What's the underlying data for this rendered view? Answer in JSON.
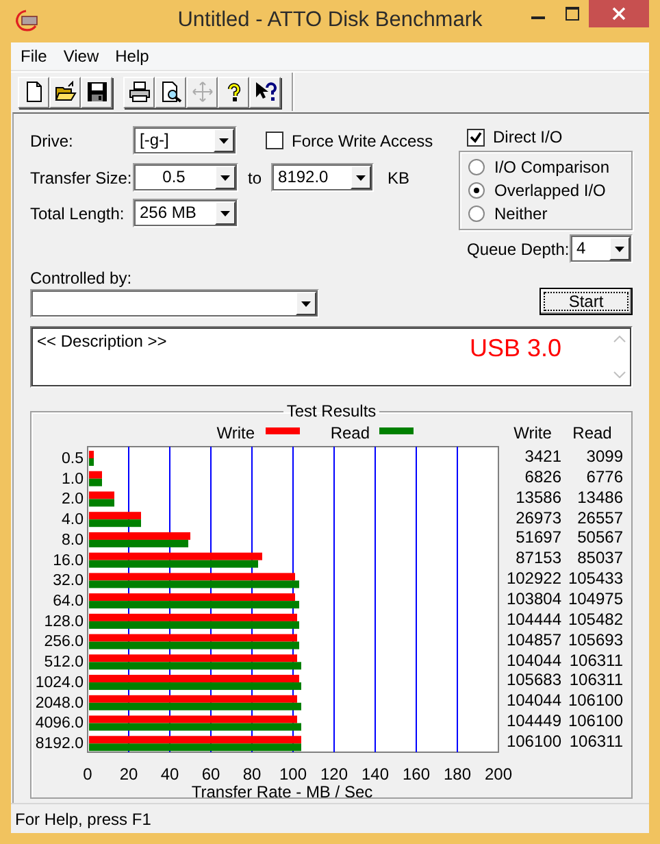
{
  "window": {
    "title": "Untitled - ATTO Disk Benchmark"
  },
  "menu": [
    "File",
    "View",
    "Help"
  ],
  "toolbar_groups": [
    [
      {
        "kind": "new",
        "disabled": false
      },
      {
        "kind": "open",
        "disabled": false
      },
      {
        "kind": "save",
        "disabled": false
      }
    ],
    [
      {
        "kind": "print",
        "disabled": false
      },
      {
        "kind": "preview",
        "disabled": false
      },
      {
        "kind": "move",
        "disabled": true
      },
      {
        "kind": "help",
        "disabled": false
      },
      {
        "kind": "context_help",
        "disabled": false
      }
    ]
  ],
  "form": {
    "drive": {
      "label": "Drive:",
      "value": "[-g-]"
    },
    "force_write_access": {
      "label": "Force Write Access",
      "checked": false
    },
    "direct_io": {
      "label": "Direct I/O",
      "checked": true
    },
    "transfer_size": {
      "label": "Transfer Size:",
      "from": "0.5",
      "to_label": "to",
      "to": "8192.0",
      "unit": "KB"
    },
    "total_length": {
      "label": "Total Length:",
      "value": "256 MB"
    },
    "io_mode": [
      {
        "label": "I/O Comparison",
        "selected": false
      },
      {
        "label": "Overlapped I/O",
        "selected": true
      },
      {
        "label": "Neither",
        "selected": false
      }
    ],
    "queue_depth": {
      "label": "Queue Depth:",
      "value": "4"
    },
    "controlled_by": {
      "label": "Controlled by:"
    },
    "start_button": "Start",
    "description": {
      "text": "<< Description >>",
      "note": "USB 3.0"
    }
  },
  "results": {
    "title": "Test Results",
    "chart_data": {
      "type": "bar",
      "orientation": "horizontal",
      "xlabel": "Transfer Rate - MB / Sec",
      "categories": [
        "0.5",
        "1.0",
        "2.0",
        "4.0",
        "8.0",
        "16.0",
        "32.0",
        "64.0",
        "128.0",
        "256.0",
        "512.0",
        "1024.0",
        "2048.0",
        "4096.0",
        "8192.0"
      ],
      "series": [
        {
          "name": "Write",
          "color": "#ff0000",
          "values": [
            3,
            7,
            13,
            26,
            50,
            85,
            101,
            101,
            102,
            102,
            102,
            103,
            102,
            102,
            104
          ]
        },
        {
          "name": "Read",
          "color": "#008000",
          "values": [
            3,
            7,
            13,
            26,
            49,
            83,
            103,
            103,
            103,
            103,
            104,
            104,
            104,
            104,
            104
          ]
        }
      ],
      "legend": true,
      "grid": true,
      "xlim": [
        0,
        200
      ],
      "xticks": [
        0,
        20,
        40,
        60,
        80,
        100,
        120,
        140,
        160,
        180,
        200
      ]
    },
    "table": {
      "columns": [
        "Write",
        "Read"
      ],
      "rows": [
        [
          "3421",
          "3099"
        ],
        [
          "6826",
          "6776"
        ],
        [
          "13586",
          "13486"
        ],
        [
          "26973",
          "26557"
        ],
        [
          "51697",
          "50567"
        ],
        [
          "87153",
          "85037"
        ],
        [
          "102922",
          "105433"
        ],
        [
          "103804",
          "104975"
        ],
        [
          "104444",
          "105482"
        ],
        [
          "104857",
          "105693"
        ],
        [
          "104044",
          "106311"
        ],
        [
          "105683",
          "106311"
        ],
        [
          "104044",
          "106100"
        ],
        [
          "104449",
          "106100"
        ],
        [
          "106100",
          "106311"
        ]
      ]
    }
  },
  "status_bar": "For Help, press F1"
}
